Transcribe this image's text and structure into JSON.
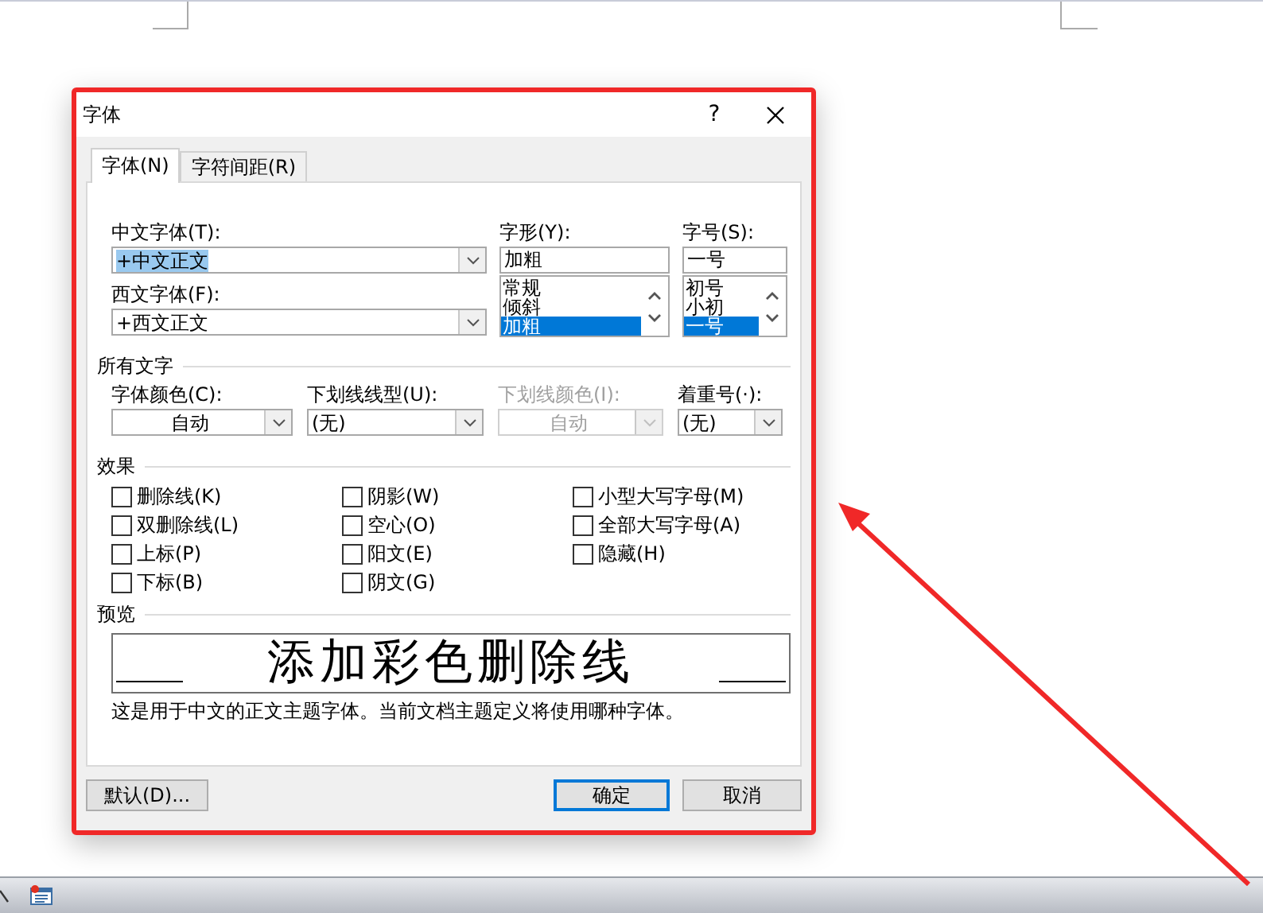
{
  "dialog": {
    "title": "字体",
    "help": "?"
  },
  "tabs": [
    {
      "label": "字体(N)",
      "selected": true
    },
    {
      "label": "字符间距(R)",
      "selected": false
    }
  ],
  "chinese_font": {
    "label": "中文字体(T):",
    "value": "+中文正文",
    "text_selected": true
  },
  "western_font": {
    "label": "西文字体(F):",
    "value": "+西文正文",
    "text_selected": false
  },
  "font_style": {
    "label": "字形(Y):",
    "value": "加粗",
    "options": [
      {
        "label": "常规",
        "selected": false
      },
      {
        "label": "倾斜",
        "selected": false
      },
      {
        "label": "加粗",
        "selected": true
      }
    ]
  },
  "font_size": {
    "label": "字号(S):",
    "value": "一号",
    "options": [
      {
        "label": "初号",
        "selected": false
      },
      {
        "label": "小初",
        "selected": false
      },
      {
        "label": "一号",
        "selected": true
      }
    ]
  },
  "all_text": {
    "heading": "所有文字",
    "fields": [
      {
        "label": "字体颜色(C):",
        "value": "自动",
        "disabled": false,
        "centered": true
      },
      {
        "label": "下划线线型(U):",
        "value": "(无)",
        "disabled": false,
        "centered": false
      },
      {
        "label": "下划线颜色(I):",
        "value": "自动",
        "disabled": true,
        "centered": true
      },
      {
        "label": "着重号(·):",
        "value": "(无)",
        "disabled": false,
        "centered": false
      }
    ]
  },
  "effects": {
    "heading": "效果",
    "columns": [
      [
        {
          "label": "删除线(K)",
          "checked": false
        },
        {
          "label": "双删除线(L)",
          "checked": false
        },
        {
          "label": "上标(P)",
          "checked": false
        },
        {
          "label": "下标(B)",
          "checked": false
        }
      ],
      [
        {
          "label": "阴影(W)",
          "checked": false
        },
        {
          "label": "空心(O)",
          "checked": false
        },
        {
          "label": "阳文(E)",
          "checked": false
        },
        {
          "label": "阴文(G)",
          "checked": false
        }
      ],
      [
        {
          "label": "小型大写字母(M)",
          "checked": false
        },
        {
          "label": "全部大写字母(A)",
          "checked": false
        },
        {
          "label": "隐藏(H)",
          "checked": false
        }
      ]
    ]
  },
  "preview": {
    "heading": "预览",
    "sample": "添加彩色删除线",
    "note": "这是用于中文的正文主题字体。当前文档主题定义将使用哪种字体。"
  },
  "buttons": [
    {
      "label": "默认(D)...",
      "default": false
    },
    {
      "label": "确定",
      "default": true
    },
    {
      "label": "取消",
      "default": false
    }
  ]
}
